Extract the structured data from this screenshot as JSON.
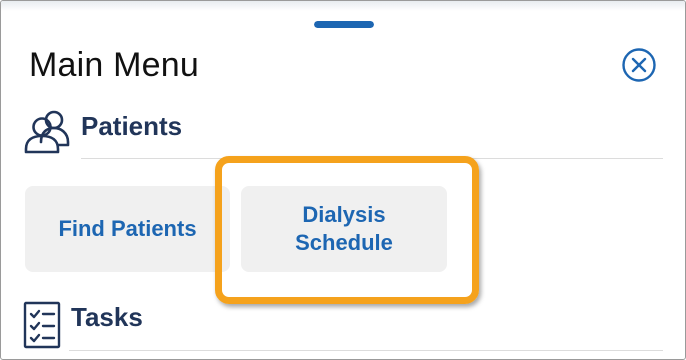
{
  "colors": {
    "accent": "#1d66b2",
    "section_text": "#213559",
    "highlight": "#f5a21c",
    "tile_bg": "#f0f0f0"
  },
  "menu": {
    "title": "Main Menu",
    "close_icon": "close-circle-icon",
    "grab_handle_icon": "drag-handle-icon"
  },
  "sections": {
    "patients": {
      "label": "Patients",
      "icon": "people-icon",
      "items": [
        {
          "label": "Find Patients"
        },
        {
          "label_line1": "Dialysis",
          "label_line2": "Schedule",
          "highlighted": true
        }
      ]
    },
    "tasks": {
      "label": "Tasks",
      "icon": "checklist-icon"
    }
  }
}
